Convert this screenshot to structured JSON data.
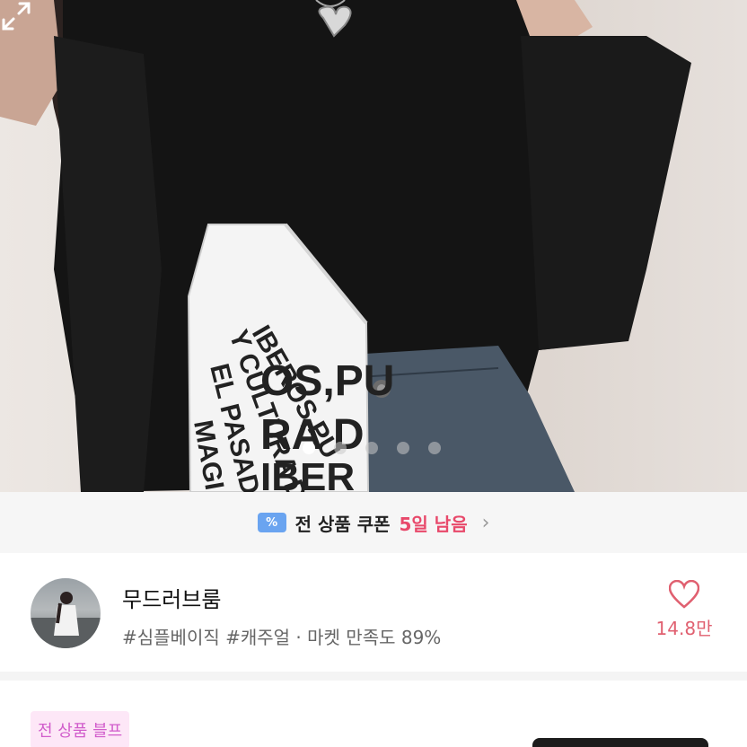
{
  "product": {
    "book_text_lines": [
      "IBEROS,PU",
      "Y CULTURA D",
      "EL PASADO IBER",
      "MAGI"
    ],
    "pagination_total": 5,
    "pagination_active": 1
  },
  "coupon": {
    "icon_glyph": "%",
    "text": "전 상품 쿠폰",
    "days_left": "5일 남음",
    "chevron": "›"
  },
  "shop": {
    "name": "무드러브룸",
    "tags": "#심플베이직 #캐주얼 · 마켓 만족도 89%",
    "like_count": "14.8만"
  },
  "promo": {
    "badge": "전 상품 블프"
  },
  "colors": {
    "accent_pink": "#e8486a",
    "coupon_blue": "#6aa4f0",
    "badge_text": "#d15ccb",
    "badge_bg": "#fde7f7"
  },
  "icons": [
    "expand-icon",
    "coupon-icon",
    "chevron-right-icon",
    "heart-icon"
  ]
}
